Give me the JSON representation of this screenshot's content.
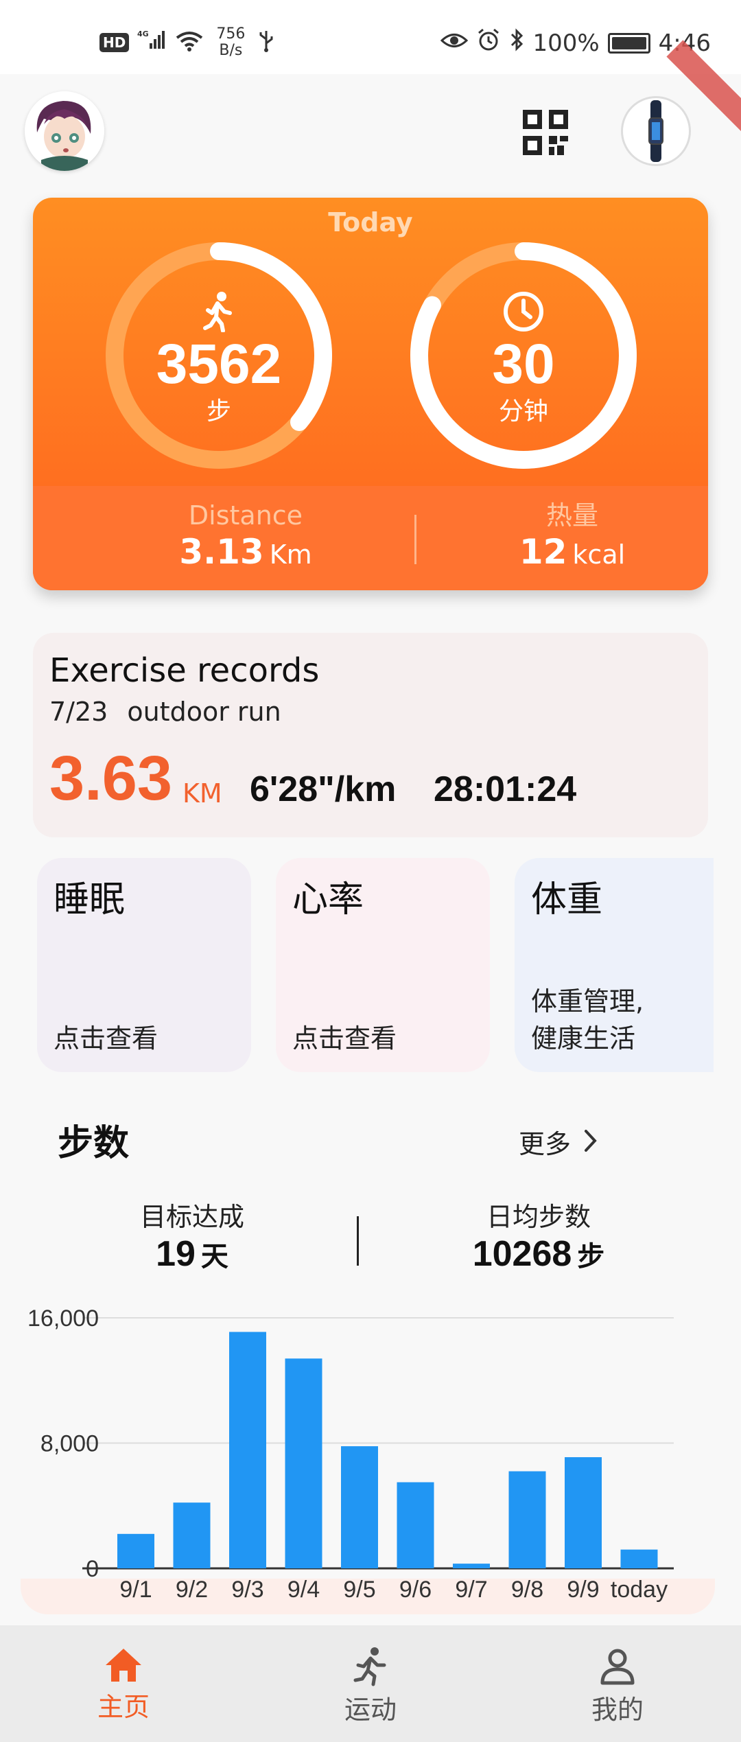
{
  "status_bar": {
    "hd": "HD",
    "signal": "4G",
    "net_speed": "756",
    "net_unit": "B/s",
    "battery": "100%",
    "battery_level": 1.0,
    "time": "4:46"
  },
  "today": {
    "title": "Today",
    "steps": {
      "value": "3562",
      "unit": "步",
      "progress": 0.36
    },
    "minutes": {
      "value": "30",
      "unit": "分钟",
      "progress": 0.83
    },
    "distance": {
      "label": "Distance",
      "value": "3.13",
      "unit": "Km"
    },
    "calories": {
      "label": "热量",
      "value": "12",
      "unit": "kcal"
    }
  },
  "exercise": {
    "title": "Exercise records",
    "date": "7/23",
    "type": "outdoor run",
    "distance": "3.63",
    "distance_unit": "KM",
    "pace": "6'28\"/km",
    "duration": "28:01:24"
  },
  "cards": [
    {
      "title": "睡眠",
      "sub": "点击查看"
    },
    {
      "title": "心率",
      "sub": "点击查看"
    },
    {
      "title": "体重",
      "sub_line1": "体重管理,",
      "sub_line2": "健康生活"
    }
  ],
  "steps_section": {
    "title": "步数",
    "more": "更多",
    "goal_label": "目标达成",
    "goal_value": "19",
    "goal_unit": "天",
    "avg_label": "日均步数",
    "avg_value": "10268",
    "avg_unit": "步"
  },
  "chart_data": {
    "type": "bar",
    "categories": [
      "9/1",
      "9/2",
      "9/3",
      "9/4",
      "9/5",
      "9/6",
      "9/7",
      "9/8",
      "9/9",
      "today"
    ],
    "values": [
      2200,
      4200,
      15100,
      13400,
      7800,
      5500,
      300,
      6200,
      7100,
      1200
    ],
    "yticks": [
      "16,000",
      "8,000",
      "0"
    ],
    "ylim": [
      0,
      16000
    ],
    "color": "#2196f3",
    "grid": true
  },
  "nav": {
    "home": "主页",
    "sport": "运动",
    "me": "我的",
    "active_color": "#f25c24"
  }
}
